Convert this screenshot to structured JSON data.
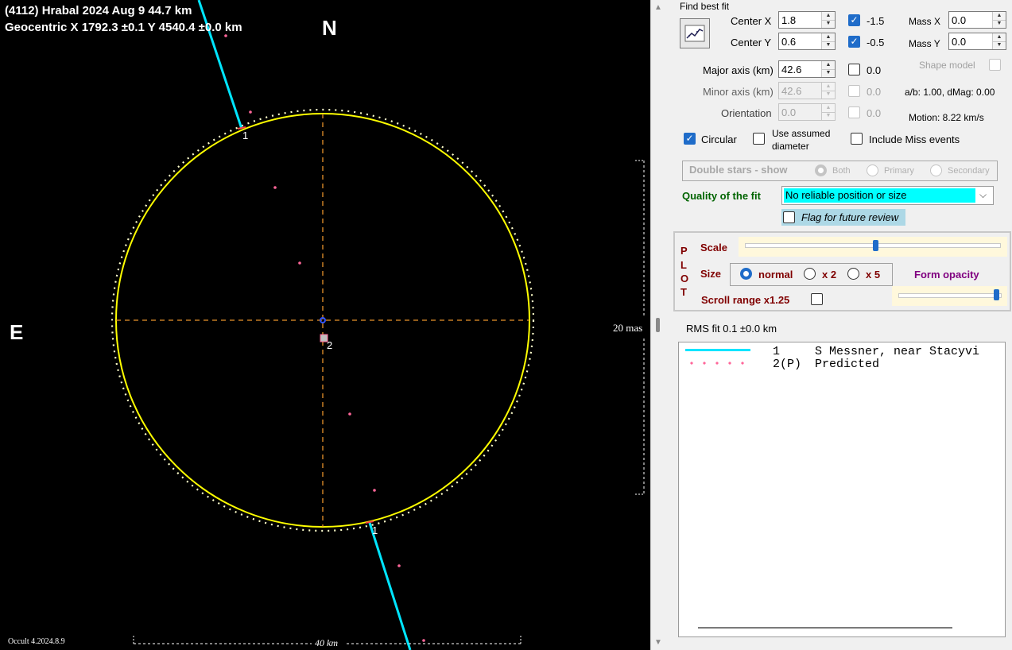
{
  "plot": {
    "title_line1": "(4112) Hrabal  2024 Aug 9   44.7 km",
    "title_line2": "Geocentric  X  1792.3 ±0.1  Y 4540.4 ±0.0 km",
    "north_label": "N",
    "east_label": "E",
    "chord1_top_label": "1",
    "chord1_bottom_label": "1",
    "center_label": "2",
    "scale_bar_label": "40 km",
    "right_scale_label": "20 mas",
    "version_label": "Occult 4.2024.8.9",
    "colors": {
      "ellipse": "#ffff00",
      "chord": "#00e5ff",
      "predicted_dots": "#ff6699",
      "axis_lines": "#e8922a"
    }
  },
  "panel": {
    "find_best_fit_label": "Find best fit",
    "center_x": {
      "label": "Center X",
      "value": "1.8",
      "check_label": "-1.5",
      "checked": true
    },
    "center_y": {
      "label": "Center Y",
      "value": "0.6",
      "check_label": "-0.5",
      "checked": true
    },
    "mass_x": {
      "label": "Mass X",
      "value": "0.0"
    },
    "mass_y": {
      "label": "Mass Y",
      "value": "0.0"
    },
    "shape_model_label": "Shape model",
    "major_axis": {
      "label": "Major axis (km)",
      "value": "42.6",
      "check_label": "0.0"
    },
    "minor_axis": {
      "label": "Minor axis (km)",
      "value": "42.6",
      "check_label": "0.0"
    },
    "orientation": {
      "label": "Orientation",
      "value": "0.0",
      "check_label": "0.0"
    },
    "ab_dmag": "a/b: 1.00, dMag: 0.00",
    "motion": "Motion: 8.22 km/s",
    "circular_label": "Circular",
    "use_assumed_line1": "Use assumed",
    "use_assumed_line2": "diameter",
    "include_miss_label": "Include Miss events",
    "double_stars_label": "Double stars - show",
    "radio_both": "Both",
    "radio_primary": "Primary",
    "radio_secondary": "Secondary",
    "quality_label": "Quality of the fit",
    "quality_value": "No reliable position or size",
    "flag_label": "Flag for future review",
    "plot_letters": [
      "P",
      "L",
      "O",
      "T"
    ],
    "scale_label": "Scale",
    "size_label": "Size",
    "size_normal": "normal",
    "size_x2": "x 2",
    "size_x5": "x 5",
    "form_opacity_label": "Form opacity",
    "scroll_range_label": "Scroll range x1.25",
    "rms_label": "RMS fit 0.1 ±0.0 km",
    "legend": [
      {
        "num": "1",
        "text": "S Messner, near Stacyvi"
      },
      {
        "num": "2(P)",
        "text": "Predicted"
      }
    ]
  }
}
